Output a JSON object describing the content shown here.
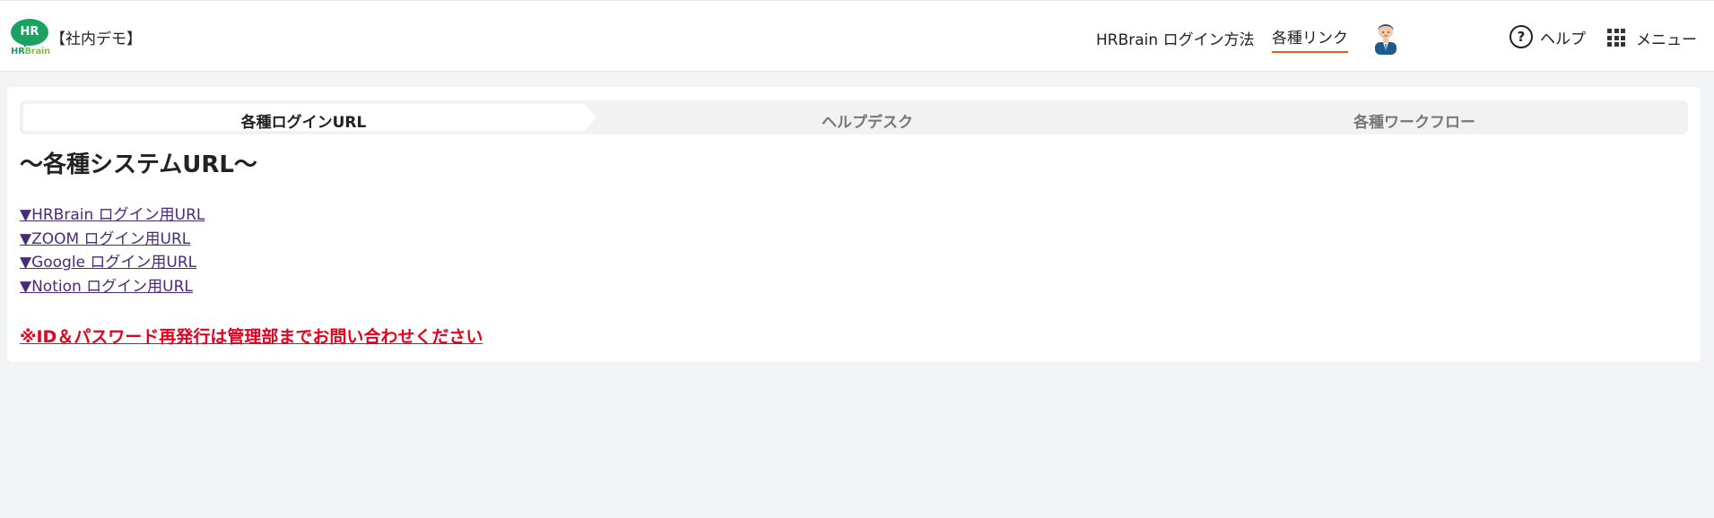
{
  "header": {
    "logo": {
      "text": "HR",
      "brand_part1": "HR",
      "brand_part2": "Brain",
      "green": "#1aa260",
      "light_green": "#7cc242"
    },
    "company": "【社内デモ】",
    "nav": {
      "login_method": "HRBrain ログイン方法",
      "links": "各種リンク",
      "active_underline": "#e0601e"
    },
    "avatar_icon": "user-avatar-icon",
    "help": {
      "icon": "question-circle-icon",
      "label": "ヘルプ"
    },
    "menu": {
      "icon": "grid-icon",
      "label": "メニュー"
    }
  },
  "tabs": [
    {
      "label": "各種ログインURL",
      "active": true
    },
    {
      "label": "ヘルプデスク",
      "active": false
    },
    {
      "label": "各種ワークフロー",
      "active": false
    }
  ],
  "content": {
    "title": "〜各種システムURL〜",
    "links": [
      "▼HRBrain ログイン用URL",
      "▼ZOOM ログイン用URL",
      "▼Google ログイン用URL",
      "▼Notion ログイン用URL"
    ],
    "notice": "※ID＆パスワード再発行は管理部までお問い合わせください",
    "link_color": "#4a2a7a",
    "notice_color": "#e8001c"
  }
}
